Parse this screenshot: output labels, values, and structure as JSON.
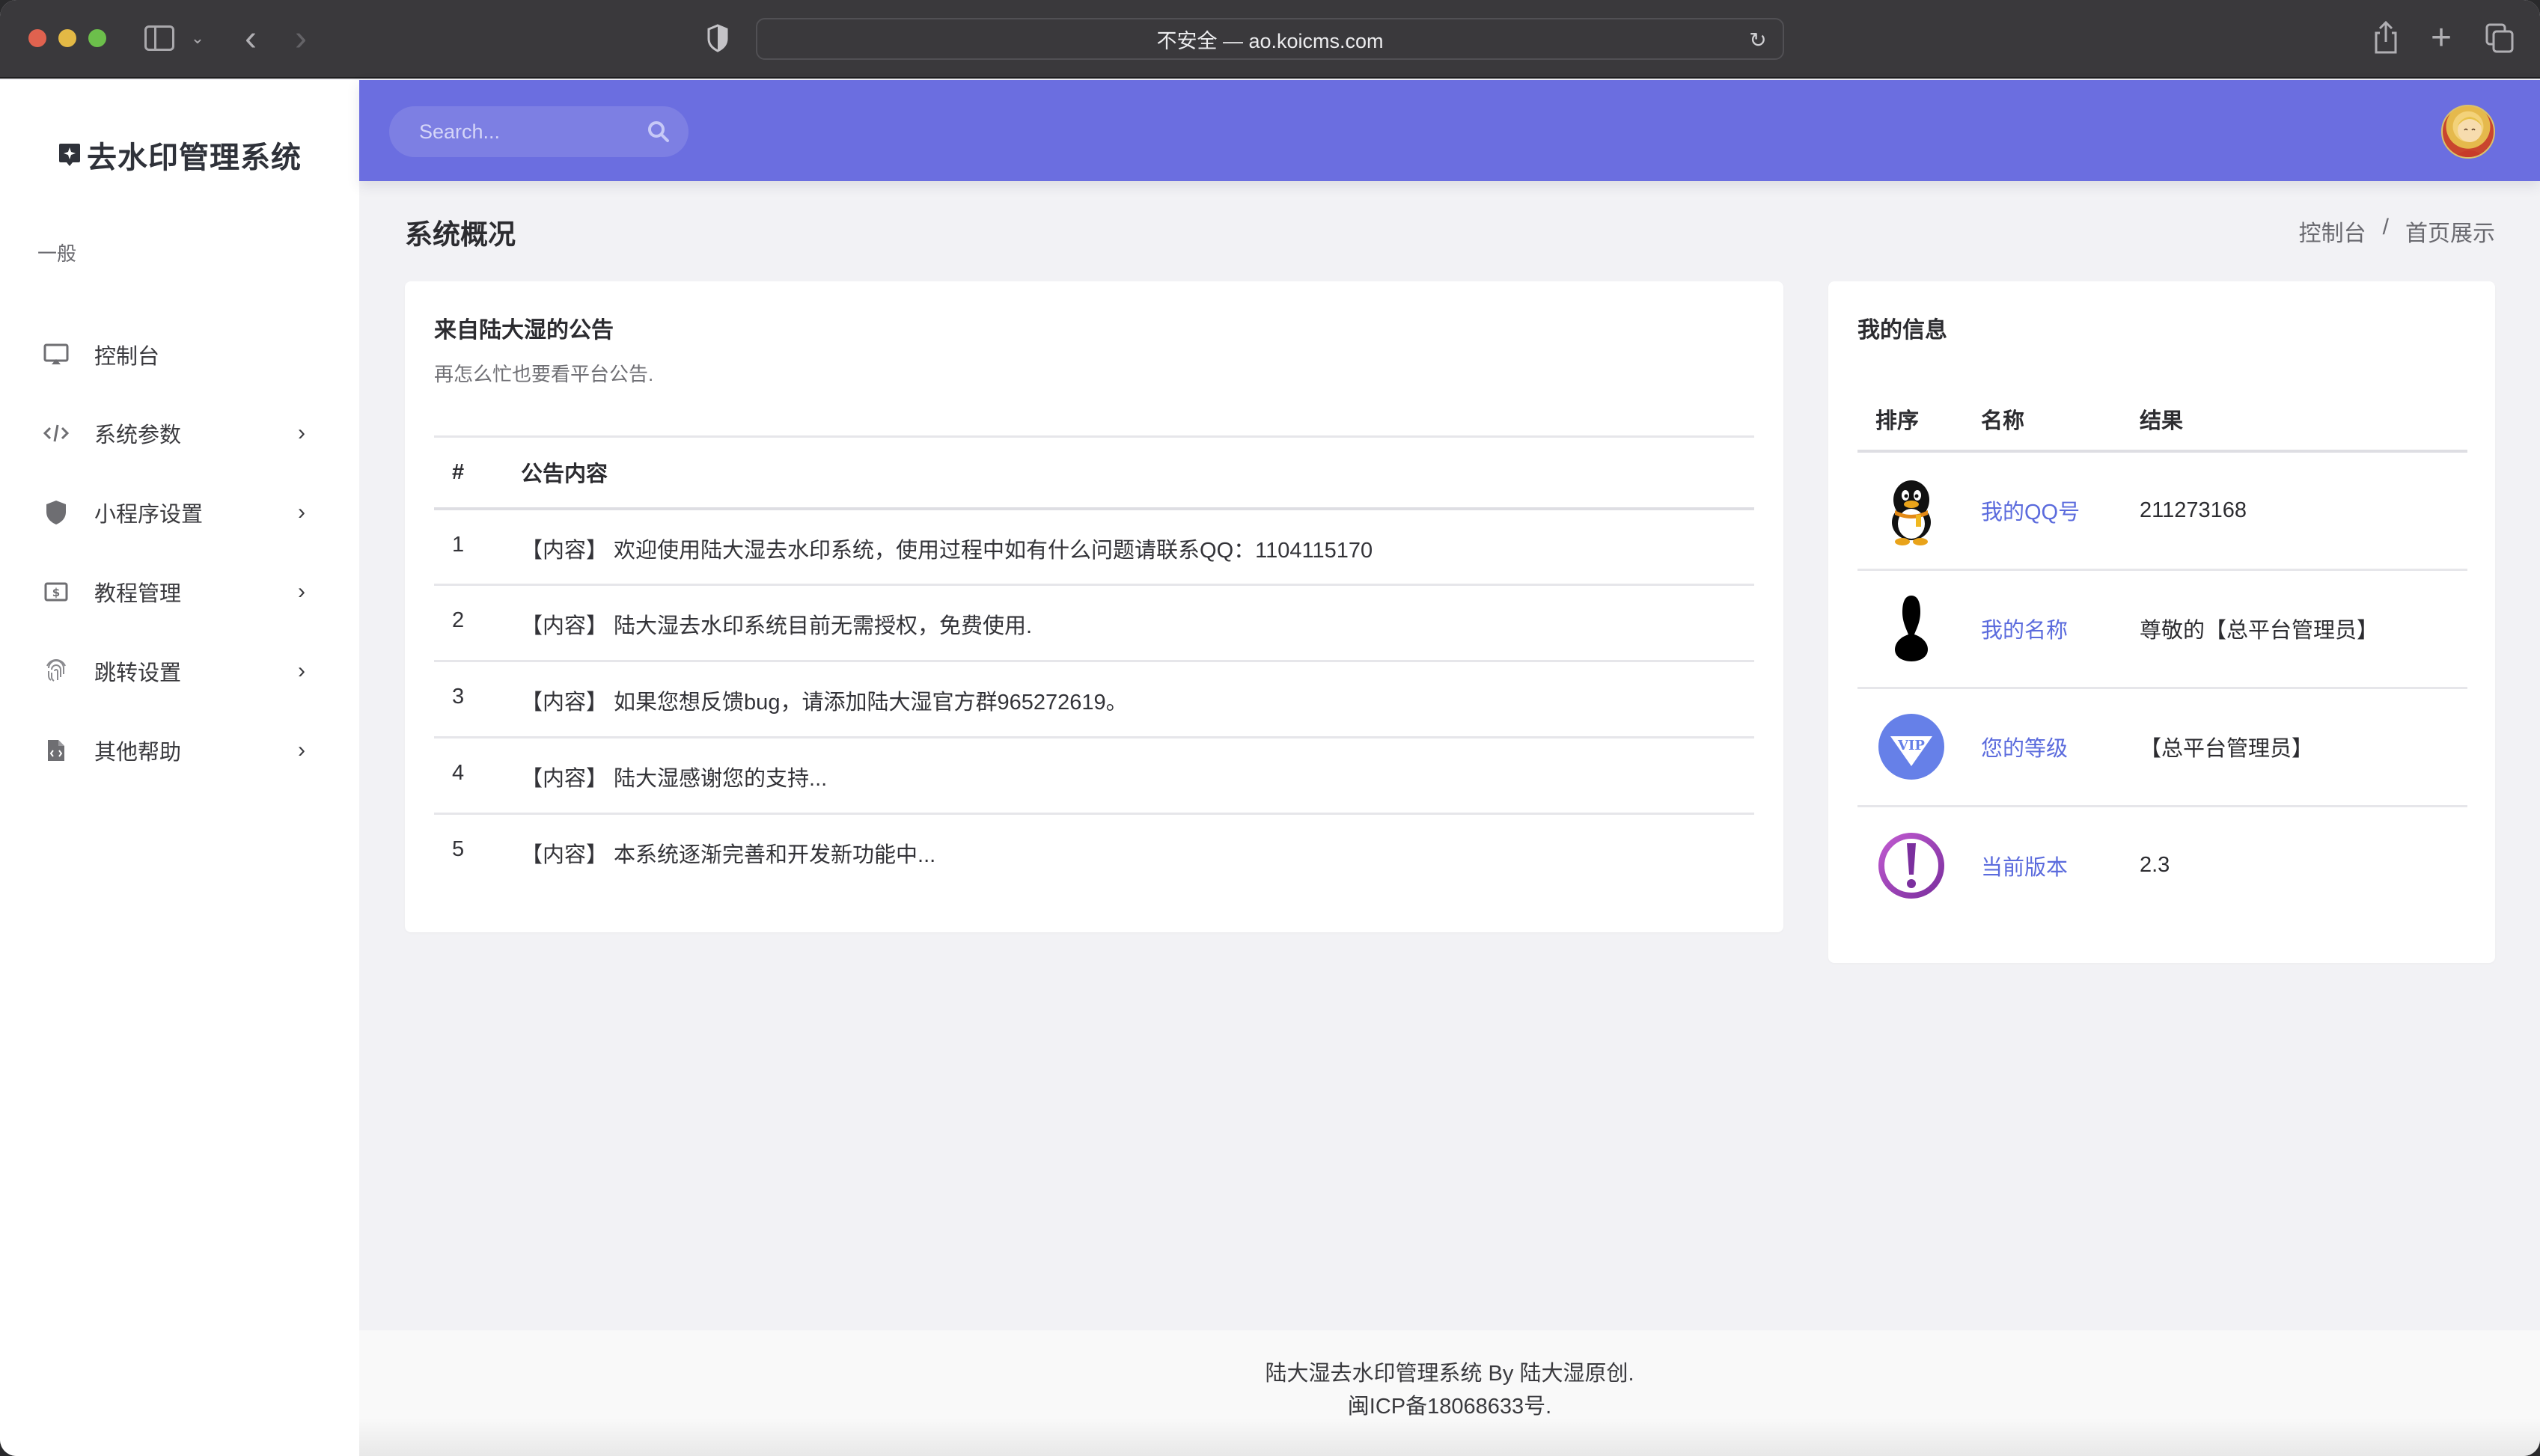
{
  "browser": {
    "url_display": "不安全 — ao.koicms.com",
    "buttons": [
      "sidebar-toggle",
      "back",
      "forward",
      "reload",
      "share",
      "new-tab",
      "tab-overview"
    ]
  },
  "sidebar": {
    "brand": "去水印管理系统",
    "section_label": "一般",
    "items": [
      {
        "label": "控制台",
        "icon": "monitor-icon",
        "has_arrow": false
      },
      {
        "label": "系统参数",
        "icon": "code-icon",
        "has_arrow": true
      },
      {
        "label": "小程序设置",
        "icon": "shield-icon",
        "has_arrow": true
      },
      {
        "label": "教程管理",
        "icon": "money-bill-icon",
        "has_arrow": true
      },
      {
        "label": "跳转设置",
        "icon": "fingerprint-icon",
        "has_arrow": true
      },
      {
        "label": "其他帮助",
        "icon": "file-code-icon",
        "has_arrow": true
      }
    ],
    "arrow_glyph": "›"
  },
  "header": {
    "search_placeholder": "Search...",
    "accent_color": "#6b6ee0"
  },
  "page": {
    "title": "系统概况",
    "breadcrumb": [
      "控制台",
      "/",
      "首页展示"
    ]
  },
  "announcements": {
    "title": "来自陆大湿的公告",
    "subtitle": "再怎么忙也要看平台公告.",
    "columns": [
      "#",
      "公告内容"
    ],
    "rows": [
      {
        "num": "1",
        "content": "【内容】 欢迎使用陆大湿去水印系统，使用过程中如有什么问题请联系QQ：1104115170"
      },
      {
        "num": "2",
        "content": "【内容】 陆大湿去水印系统目前无需授权，免费使用."
      },
      {
        "num": "3",
        "content": "【内容】 如果您想反馈bug，请添加陆大湿官方群965272619。"
      },
      {
        "num": "4",
        "content": "【内容】 陆大湿感谢您的支持..."
      },
      {
        "num": "5",
        "content": "【内容】 本系统逐渐完善和开发新功能中..."
      }
    ]
  },
  "my_info": {
    "title": "我的信息",
    "columns": [
      "排序",
      "名称",
      "结果"
    ],
    "rows": [
      {
        "icon": "qq-penguin-icon",
        "name": "我的QQ号",
        "value": "211273168"
      },
      {
        "icon": "user-silhouette-icon",
        "name": "我的名称",
        "value": "尊敬的【总平台管理员】"
      },
      {
        "icon": "vip-badge-icon",
        "name": "您的等级",
        "value": "【总平台管理员】"
      },
      {
        "icon": "exclamation-circle-icon",
        "name": "当前版本",
        "value": "2.3"
      }
    ],
    "link_color": "#5b6bdd"
  },
  "footer": {
    "line1": "陆大湿去水印管理系统 By 陆大湿原创.",
    "line2": "闽ICP备18068633号."
  }
}
